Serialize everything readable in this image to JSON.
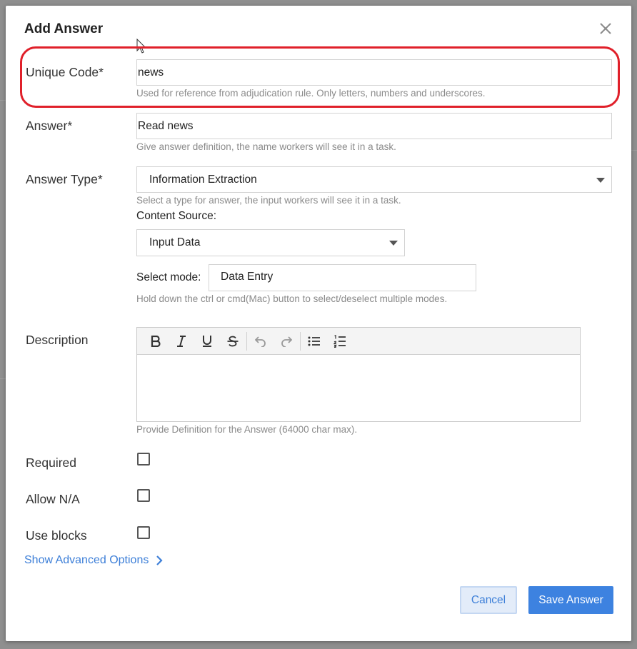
{
  "dialog": {
    "title": "Add Answer"
  },
  "fields": {
    "unique_code": {
      "label": "Unique Code*",
      "value": "news",
      "help": "Used for reference from adjudication rule. Only letters, numbers and underscores."
    },
    "answer": {
      "label": "Answer*",
      "value": "Read news",
      "help": "Give answer definition, the name workers will see it in a task."
    },
    "answer_type": {
      "label": "Answer Type*",
      "value": "Information Extraction",
      "help": "Select a type for answer, the input workers will see it in a task."
    },
    "content_source": {
      "label": "Content Source:",
      "value": "Input Data"
    },
    "select_mode": {
      "label": "Select mode:",
      "value": "Data Entry",
      "help": "Hold down the ctrl or cmd(Mac) button to select/deselect multiple modes."
    },
    "description": {
      "label": "Description",
      "help": "Provide Definition for the Answer (64000 char max).",
      "toolbar": [
        "bold-icon",
        "italic-icon",
        "underline-icon",
        "strikethrough-icon",
        "undo-icon",
        "redo-icon",
        "bullet-list-icon",
        "numbered-list-icon"
      ]
    },
    "required": {
      "label": "Required",
      "checked": false
    },
    "allow_na": {
      "label": "Allow N/A",
      "checked": false
    },
    "use_blocks": {
      "label": "Use blocks",
      "checked": false
    }
  },
  "advanced": {
    "label": "Show Advanced Options"
  },
  "buttons": {
    "cancel": "Cancel",
    "save": "Save Answer"
  },
  "colors": {
    "accent": "#3d82e0",
    "link": "#3d7fd8",
    "highlight": "#e0202a"
  }
}
